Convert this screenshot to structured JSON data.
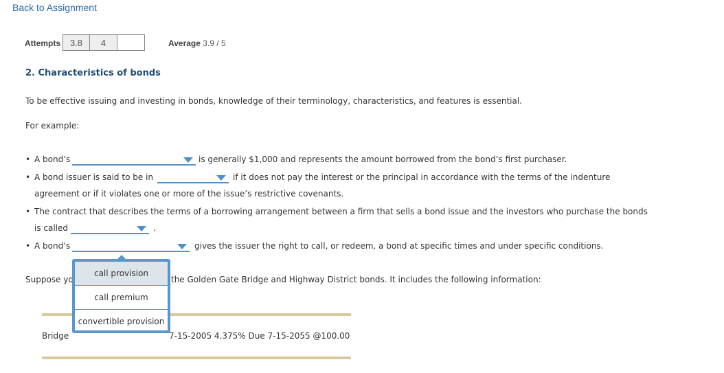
{
  "nav": {
    "back_link": "Back to Assignment"
  },
  "attempts": {
    "label": "Attempts",
    "values": [
      "3.8",
      "4",
      ""
    ],
    "average_label": "Average",
    "average_value": "3.9 / 5"
  },
  "question": {
    "title": "2. Characteristics of bonds",
    "intro": "To be effective issuing and investing in bonds, knowledge of their terminology, characteristics, and features is essential.",
    "for_example": "For example:",
    "bullets": [
      {
        "before": "A bond’s",
        "after": "is generally $1,000 and represents the amount borrowed from the bond’s first purchaser."
      },
      {
        "before": "A bond issuer is said to be in",
        "after": "if it does not pay the interest or the principal in accordance with the terms of the indenture",
        "line2": "agreement or if it violates one or more of the issue’s restrictive covenants."
      },
      {
        "before": "The contract that describes the terms of a borrowing arrangement between a firm that sells a bond issue and the investors who purchase the bonds",
        "line2_before": "is called",
        "line2_after": "."
      },
      {
        "before": "A bond’s",
        "after": "gives the issuer the right to call, or redeem, a bond at specific times and under specific conditions."
      }
    ],
    "suppose_start": "Suppose yo",
    "suppose_end": "the Golden Gate Bridge and Highway District bonds. It includes the following information:",
    "bond_info_start": "Bridge ",
    "bond_info_end": "7-15-2005 4.375% Due 7-15-2055 @100.00"
  },
  "dropdown_popup": {
    "options": [
      "call provision",
      "call premium",
      "convertible provision"
    ],
    "highlighted_index": 0
  },
  "colors": {
    "link": "#2b6aa8",
    "title": "#1f4e79",
    "accent": "#5a96c8",
    "rule": "#d8ca9e"
  }
}
